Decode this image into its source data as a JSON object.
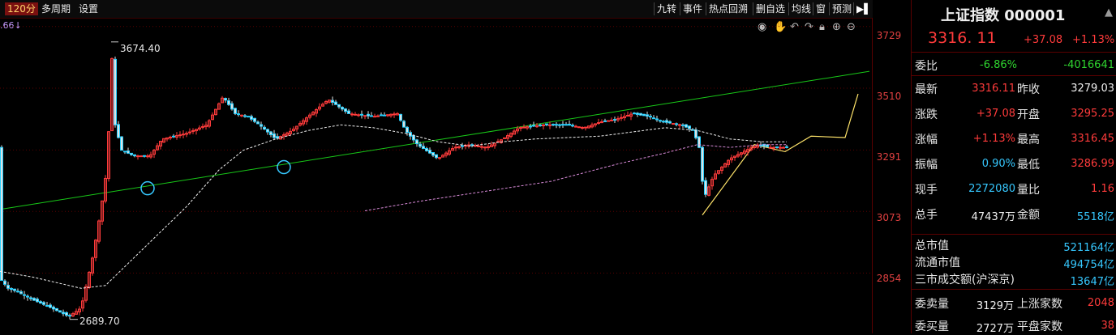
{
  "toolbar": {
    "period": "120分",
    "multi_period": "多周期",
    "settings": "设置",
    "ma_value": ".66↓",
    "right_tabs": [
      "九转",
      "事件",
      "热点回溯",
      "删自选",
      "均线",
      "窗",
      "预测"
    ]
  },
  "chart_annotations": {
    "high_label": "3674.40",
    "low_label": "2689.70"
  },
  "chart_data": {
    "type": "candlestick",
    "y_axis_ticks": [
      "3729",
      "3510",
      "3291",
      "3073",
      "2854"
    ],
    "ylim": [
      2640,
      3760
    ],
    "high": 3674.4,
    "low": 2689.7,
    "last": 3316.11,
    "trendline_color": "#18c818",
    "up_color": "#ff3b3b",
    "down_color": "#24d0ff"
  },
  "quote": {
    "name": "上证指数",
    "code": "000001",
    "price": "3316. 11",
    "change": "+37.08",
    "change_pct": "+1.13%"
  },
  "panel": {
    "row_weibi": {
      "label": "委比",
      "v1": "-6.86%",
      "v2": "-4016641"
    },
    "rows": [
      {
        "l1": "最新",
        "v1": "3316.11",
        "l2": "昨收",
        "v2": "3279.03"
      },
      {
        "l1": "涨跌",
        "v1": "+37.08",
        "l2": "开盘",
        "v2": "3295.25"
      },
      {
        "l1": "涨幅",
        "v1": "+1.13%",
        "l2": "最高",
        "v2": "3316.45"
      },
      {
        "l1": "振幅",
        "v1": "0.90%",
        "l2": "最低",
        "v2": "3286.99"
      },
      {
        "l1": "现手",
        "v1": "2272080",
        "l2": "量比",
        "v2": "1.16"
      },
      {
        "l1": "总手",
        "v1": "47437万",
        "l2": "金额",
        "v2": "5518亿"
      }
    ],
    "market": [
      {
        "label": "总市值",
        "value": "521164亿"
      },
      {
        "label": "流通市值",
        "value": "494754亿"
      },
      {
        "label": "三市成交额(沪深京)",
        "value": "13647亿"
      }
    ],
    "bottom": [
      {
        "l1": "委卖量",
        "v1": "3129万",
        "l2": "上涨家数",
        "v2": "2048"
      },
      {
        "l1": "委买量",
        "v1": "2727万",
        "l2": "平盘家数",
        "v2": "38"
      }
    ]
  }
}
